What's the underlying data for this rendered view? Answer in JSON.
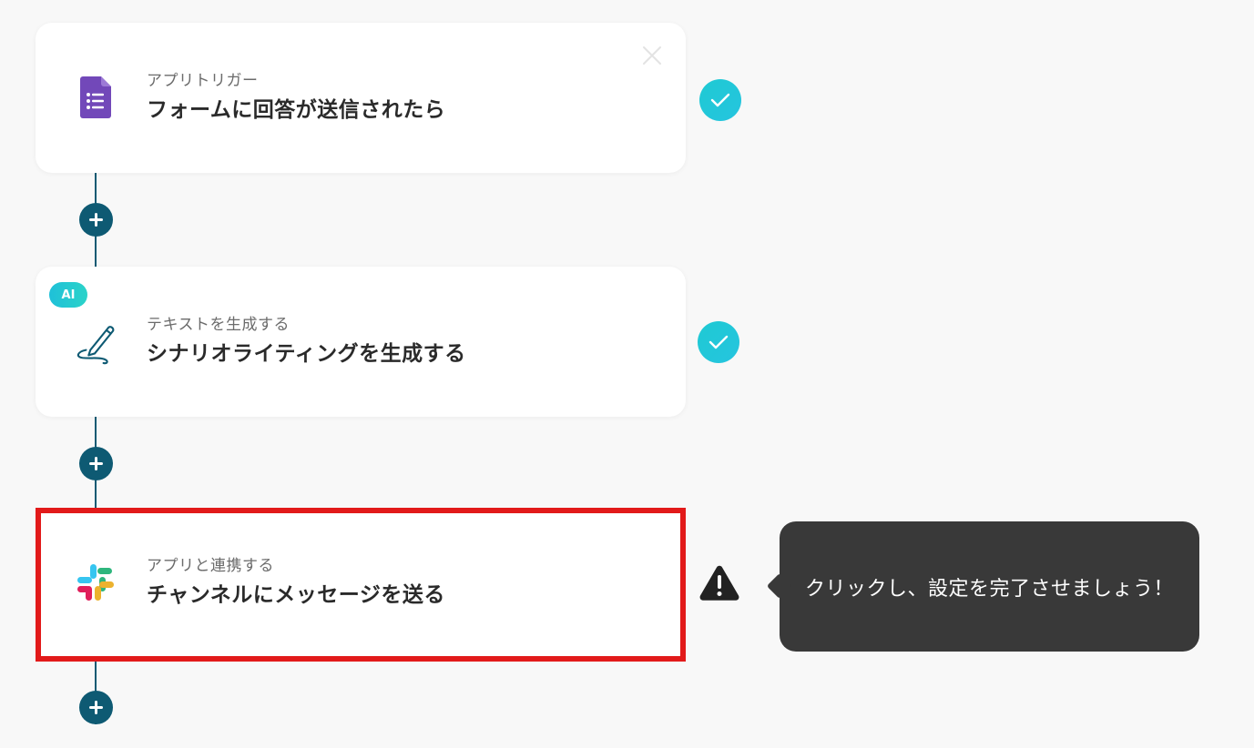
{
  "flow": {
    "steps": [
      {
        "icon": "google-forms-icon",
        "subtitle": "アプリトリガー",
        "title": "フォームに回答が送信されたら",
        "status": "check-icon"
      },
      {
        "icon": "pen-icon",
        "badge": "AI",
        "subtitle": "テキストを生成する",
        "title": "シナリオライティングを生成する",
        "status": "check-icon"
      },
      {
        "icon": "slack-icon",
        "subtitle": "アプリと連携する",
        "title": "チャンネルにメッセージを送る",
        "status": "warning-icon"
      }
    ]
  },
  "tooltip": {
    "text": "クリックし、設定を完了させましょう！"
  },
  "colors": {
    "background": "#f8f8f8",
    "flow_line": "#0e5a73",
    "check": "#1fcad3",
    "highlight_border": "#e21a1a",
    "tooltip_bg": "#393939"
  }
}
